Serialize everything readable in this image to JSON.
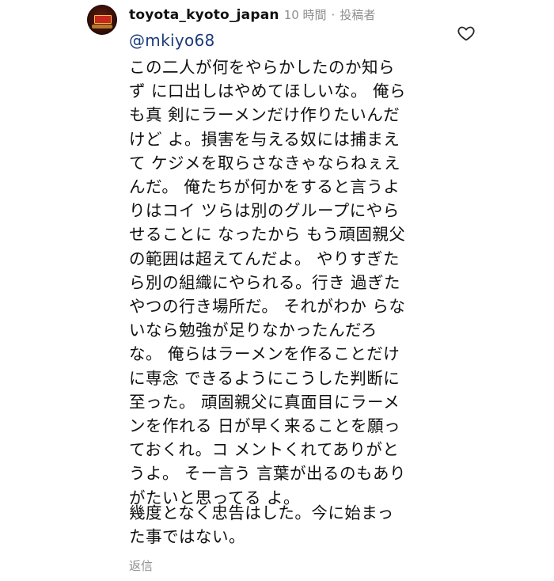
{
  "comment": {
    "username": "toyota_kyoto_japan",
    "time": "10 時間",
    "separator": "·",
    "role_badge": "投稿者",
    "mention": "@mkiyo68",
    "paragraph1_lines": [
      "この二人が何をやらかしたのか知ら",
      "ず に口出しはやめてほしいな。 俺ら",
      "も真 剣にラーメンだけ作りたいんだ",
      "けど よ。損害を与える奴には捕まえ",
      "て ケジメを取らさなきゃならねぇえ",
      "んだ。 俺たちが何かをすると言うよ",
      "りはコイ ツらは別のグループにやら",
      "せることに なったから もう頑固親父",
      "の範囲は超えてんだよ。 やりすぎた",
      "ら別の組織にやられる。行き 過ぎた",
      "やつの行き場所だ。 それがわか らな",
      "いなら勉強が足りなかったんだろ",
      "な。 俺らはラーメンを作ることだけ",
      "に専念 できるようにこうした判断に",
      "至った。 頑固親父に真面目にラーメ",
      "ンを作れる 日が早く来ることを願っ",
      "ておくれ。コ メントくれてありがと",
      "うよ。 そー言う 言葉が出るのもあり",
      "がたいと思ってる よ。"
    ],
    "paragraph2_lines": [
      "幾度となく忠告はした。今に始まっ",
      "た事ではない。"
    ],
    "reply_label": "返信",
    "like_icon": "heart-outline-icon",
    "avatar_icon": "shop-sign-avatar"
  },
  "colors": {
    "mention": "#1a3a7a",
    "meta": "#8e8e8e",
    "text": "#111111"
  }
}
